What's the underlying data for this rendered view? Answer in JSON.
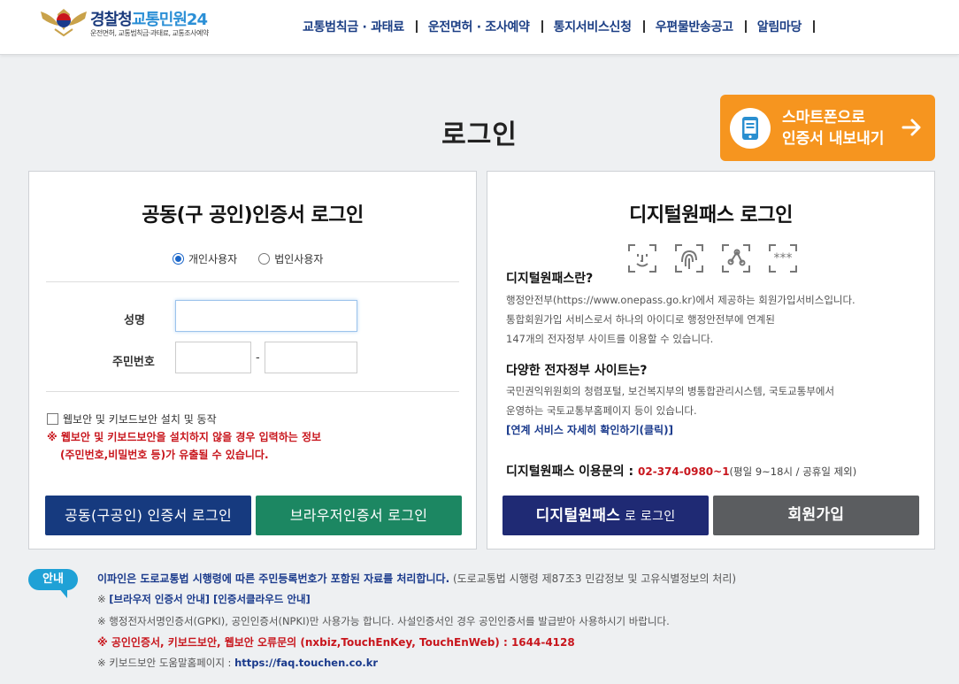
{
  "header": {
    "brand_main": "경찰청",
    "brand_sub": "교통민원24",
    "brand_desc": "운전면허, 교통범칙금·과태료, 교통조사예약",
    "nav": [
      "교통범칙금 · 과태료",
      "운전면허 · 조사예약",
      "통지서비스신청",
      "우편물반송공고",
      "알림마당"
    ]
  },
  "page_title": "로그인",
  "smart_btn": {
    "line1": "스마트폰으로",
    "line2": "인증서 내보내기"
  },
  "cert_login": {
    "title": "공동(구 공인)인증서 로그인",
    "radio_personal": "개인사용자",
    "radio_corp": "법인사용자",
    "name_label": "성명",
    "rrn_label": "주민번호",
    "dash": "-",
    "security_check": "웹보안 및 키보드보안 설치 및 동작",
    "warning1": "※ 웹보안 및 키보드보안을 설치하지 않을 경우 입력하는 정보",
    "warning2": "(주민번호,비밀번호 등)가 유출될 수 있습니다.",
    "btn_cert": "공동(구공인) 인증서 로그인",
    "btn_browser": "브라우저인증서 로그인"
  },
  "onepass": {
    "title": "디지털원패스 로그인",
    "h1": "디지털원패스란?",
    "p1": "행정안전부(https://www.onepass.go.kr)에서 제공하는 회원가입서비스입니다.",
    "p2": "통합회원가입 서비스로서 하나의 아이디로 행정안전부에 연계된",
    "p3": "147개의 전자정부 사이트를 이용할 수 있습니다.",
    "h2": "다양한 전자정부 사이트는?",
    "p4": "국민권익위원회의 청렴포털, 보건복지부의 병통합관리시스템, 국토교통부에서",
    "p5": "운영하는 국토교통부홈페이지 등이 있습니다.",
    "link": "[연계 서비스 자세히 확인하기(클릭)]",
    "contact_label": "디지털원패스 이용문의 : ",
    "contact_phone": "02-374-0980~1",
    "contact_hours": "(평일 9~18시 / 공휴일 제외)",
    "btn_onepass_main": "디지털원패스",
    "btn_onepass_sub": " 로 로그인",
    "btn_join": "회원가입"
  },
  "notice": {
    "badge": "안내",
    "line1": "이파인은 도로교통법 시행령에 따른 주민등록번호가 포함된 자료를 처리합니다.",
    "line1_sub": " (도로교통법 시행령 제87조3 민감정보 및 고유식별정보의 처리)",
    "line2_prefix": "※ ",
    "line2_link1": "[브라우저 인증서 안내]",
    "line2_link2": " [인증서클라우드 안내]",
    "line3": "※ 행정전자서명인증서(GPKI), 공인인증서(NPKI)만 사용가능 합니다. 사설인증서인 경우 공인인증서를 발급받아 사용하시기 바랍니다.",
    "line4": "※ 공인인증서, 키보드보안, 웹보안 오류문의 (nxbiz,TouchEnKey, TouchEnWeb) : 1644-4128",
    "line5_prefix": "※ 키보드보안 도움말홈페이지 : ",
    "line5_url": "https://faq.touchen.co.kr"
  },
  "colors": {
    "navy": "#163a7f",
    "green": "#1c8762",
    "onepass": "#1f2a74",
    "join": "#5b5d60",
    "orange": "#f6951f",
    "red": "#c8161d"
  }
}
